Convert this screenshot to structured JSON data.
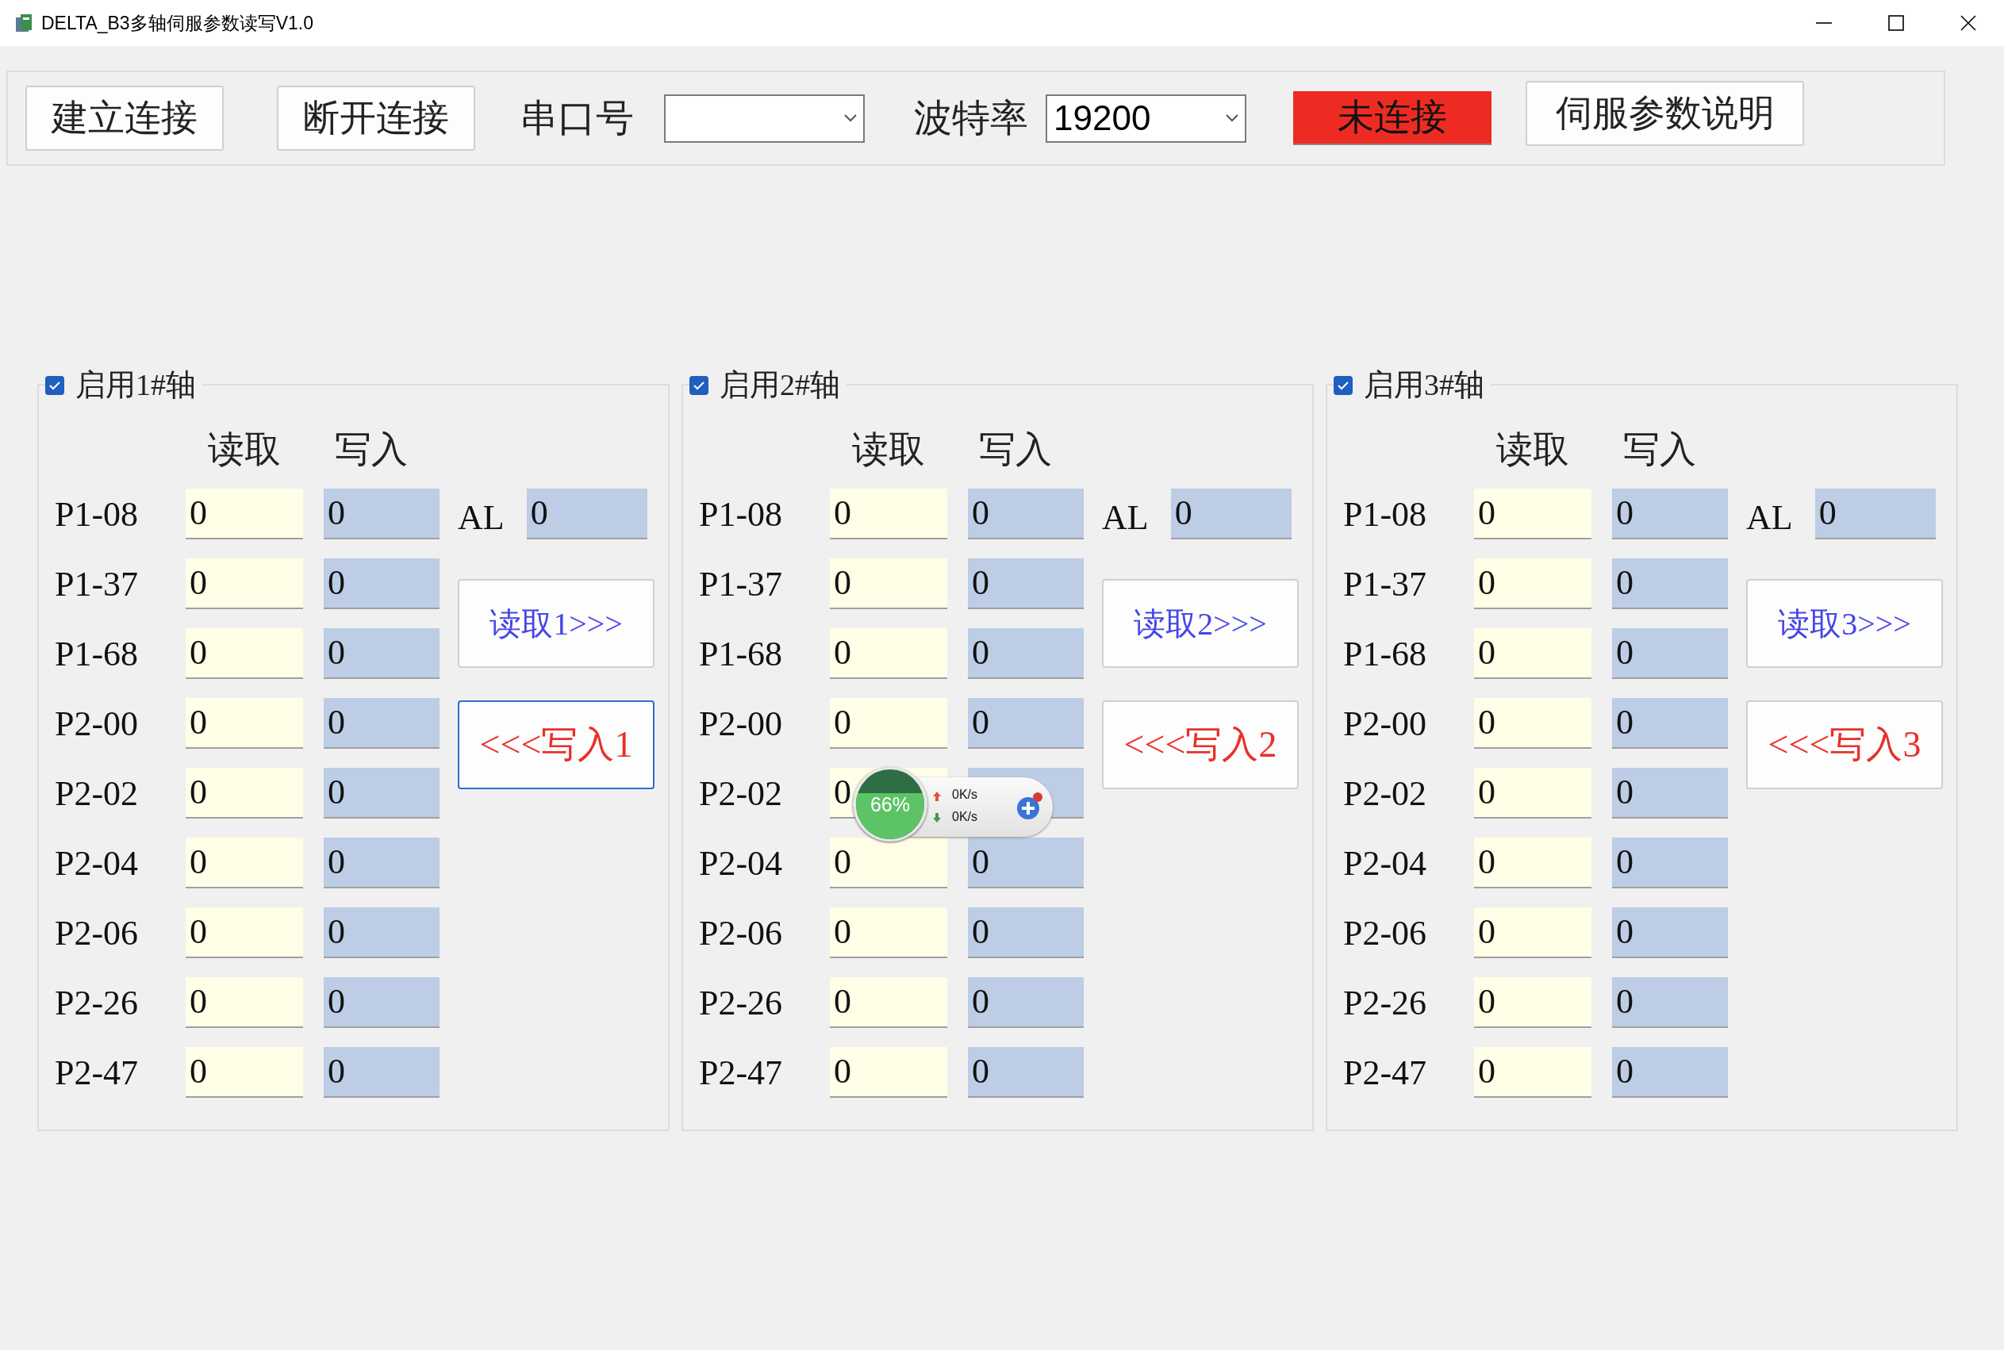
{
  "window": {
    "title": "DELTA_B3多轴伺服参数读写V1.0"
  },
  "toolbar": {
    "connect_button": "建立连接",
    "disconnect_button": "断开连接",
    "port_label": "串口号",
    "baud_label": "波特率",
    "baud_value": "19200",
    "status": {
      "text": "未连接",
      "connected": false
    },
    "help_button": "伺服参数说明"
  },
  "axes": [
    {
      "label": "启用1#轴",
      "checked": true,
      "columns": [
        "读取",
        "写入"
      ],
      "al_label": "AL",
      "al_value": "0",
      "read_button": "读取1>>>",
      "write_button": "<<<写入1",
      "write_focused": true,
      "params": [
        {
          "name": "P1-08",
          "read": "0",
          "write": "0"
        },
        {
          "name": "P1-37",
          "read": "0",
          "write": "0"
        },
        {
          "name": "P1-68",
          "read": "0",
          "write": "0"
        },
        {
          "name": "P2-00",
          "read": "0",
          "write": "0"
        },
        {
          "name": "P2-02",
          "read": "0",
          "write": "0"
        },
        {
          "name": "P2-04",
          "read": "0",
          "write": "0"
        },
        {
          "name": "P2-06",
          "read": "0",
          "write": "0"
        },
        {
          "name": "P2-26",
          "read": "0",
          "write": "0"
        },
        {
          "name": "P2-47",
          "read": "0",
          "write": "0"
        }
      ]
    },
    {
      "label": "启用2#轴",
      "checked": true,
      "columns": [
        "读取",
        "写入"
      ],
      "al_label": "AL",
      "al_value": "0",
      "read_button": "读取2>>>",
      "write_button": "<<<写入2",
      "write_focused": false,
      "params": [
        {
          "name": "P1-08",
          "read": "0",
          "write": "0"
        },
        {
          "name": "P1-37",
          "read": "0",
          "write": "0"
        },
        {
          "name": "P1-68",
          "read": "0",
          "write": "0"
        },
        {
          "name": "P2-00",
          "read": "0",
          "write": "0"
        },
        {
          "name": "P2-02",
          "read": "0"
        },
        {
          "name": "P2-04",
          "read": "0",
          "write": "0"
        },
        {
          "name": "P2-06",
          "read": "0",
          "write": "0"
        },
        {
          "name": "P2-26",
          "read": "0",
          "write": "0"
        },
        {
          "name": "P2-47",
          "read": "0",
          "write": "0"
        }
      ]
    },
    {
      "label": "启用3#轴",
      "checked": true,
      "columns": [
        "读取",
        "写入"
      ],
      "al_label": "AL",
      "al_value": "0",
      "read_button": "读取3>>>",
      "write_button": "<<<写入3",
      "write_focused": false,
      "params": [
        {
          "name": "P1-08",
          "read": "0",
          "write": "0"
        },
        {
          "name": "P1-37",
          "read": "0",
          "write": "0"
        },
        {
          "name": "P1-68",
          "read": "0",
          "write": "0"
        },
        {
          "name": "P2-00",
          "read": "0",
          "write": "0"
        },
        {
          "name": "P2-02",
          "read": "0",
          "write": "0"
        },
        {
          "name": "P2-04",
          "read": "0",
          "write": "0"
        },
        {
          "name": "P2-06",
          "read": "0",
          "write": "0"
        },
        {
          "name": "P2-26",
          "read": "0",
          "write": "0"
        },
        {
          "name": "P2-47",
          "read": "0",
          "write": "0"
        }
      ]
    }
  ],
  "speed_widget": {
    "reading": "66%",
    "level": 0.66,
    "upload": "0K/s",
    "download": "0K/s"
  }
}
